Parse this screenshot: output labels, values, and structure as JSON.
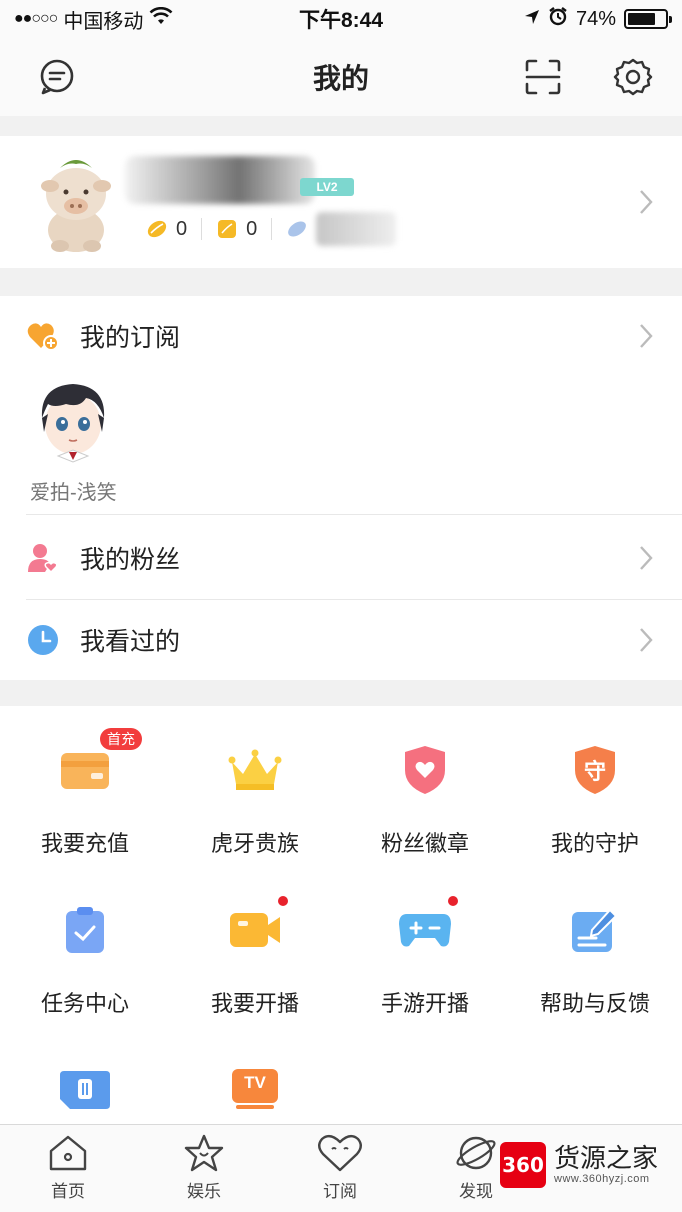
{
  "status_bar": {
    "signal": "●●○○○",
    "carrier": "中国移动",
    "time": "下午8:44",
    "battery": "74%",
    "battery_level": 0.74
  },
  "nav": {
    "title": "我的"
  },
  "profile": {
    "level_badge": "LV2",
    "gold_beans": "0",
    "silver_beans": "0"
  },
  "subscription": {
    "label": "我的订阅",
    "anchor_name": "爱拍-浅笑"
  },
  "list": {
    "fans_label": "我的粉丝",
    "history_label": "我看过的"
  },
  "grid": {
    "recharge": "我要充值",
    "recharge_tag": "首充",
    "noble": "虎牙贵族",
    "fan_badge": "粉丝徽章",
    "guard": "我的守护",
    "guard_glyph": "守",
    "task": "任务中心",
    "broadcast": "我要开播",
    "mobile_game": "手游开播",
    "feedback": "帮助与反馈",
    "tv_glyph": "TV"
  },
  "tabbar": {
    "home": "首页",
    "entertainment": "娱乐",
    "subscribe": "订阅",
    "discover": "发现"
  },
  "watermark": {
    "logo": "360",
    "title": "货源之家",
    "url": "www.360hyzj.com"
  },
  "colors": {
    "accent_orange": "#f7a531",
    "pink": "#f35f7b",
    "blue": "#4a9ef5",
    "red_badge": "#f23d3d"
  }
}
